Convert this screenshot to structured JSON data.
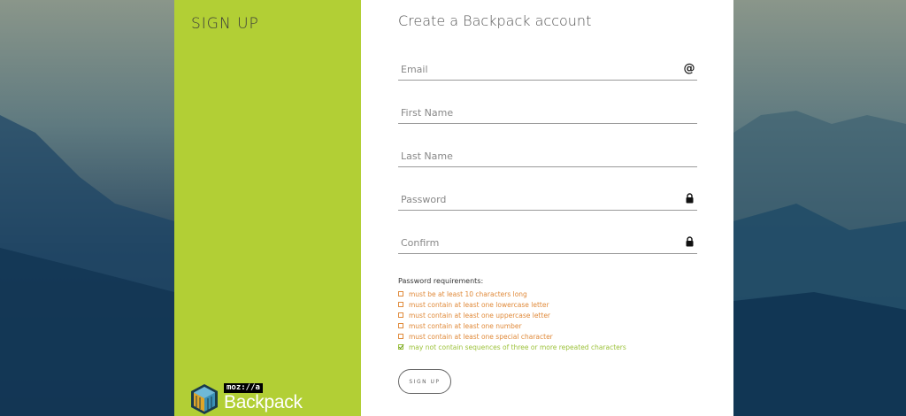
{
  "sidebar": {
    "title": "SIGN UP",
    "logo_tag": "moz://a",
    "logo_name": "Backpack"
  },
  "form": {
    "title": "Create a Backpack account",
    "fields": [
      {
        "placeholder": "Email",
        "icon": "at-icon"
      },
      {
        "placeholder": "First Name"
      },
      {
        "placeholder": "Last Name"
      },
      {
        "placeholder": "Password",
        "icon": "lock-icon"
      },
      {
        "placeholder": "Confirm",
        "icon": "lock-icon"
      }
    ],
    "requirements_title": "Password requirements:",
    "requirements": [
      {
        "text": "must be at least 10 characters long",
        "met": false
      },
      {
        "text": "must contain at least one lowercase letter",
        "met": false
      },
      {
        "text": "must contain at least one uppercase letter",
        "met": false
      },
      {
        "text": "must contain at least one number",
        "met": false
      },
      {
        "text": "must contain at least one special character",
        "met": false
      },
      {
        "text": "may not contain sequences of three or more repeated characters",
        "met": true
      }
    ],
    "submit_label": "SIGN UP"
  },
  "colors": {
    "sidebar_bg": "#b2cf35",
    "unmet": "#e08a3a",
    "met": "#9cc23a"
  }
}
